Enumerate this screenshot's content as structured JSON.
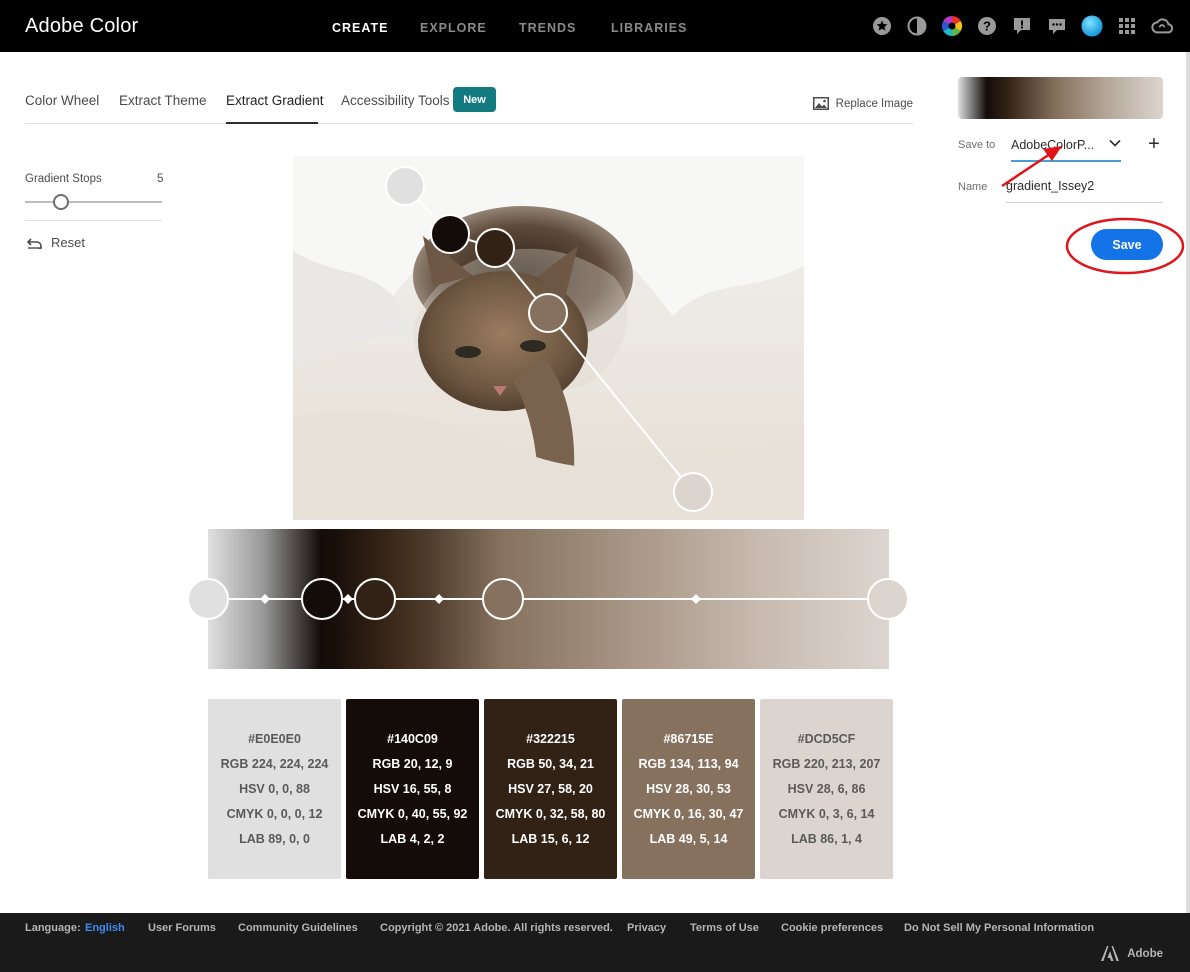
{
  "app": {
    "brand": "Adobe Color",
    "nav": [
      {
        "label": "CREATE",
        "active": true
      },
      {
        "label": "EXPLORE",
        "active": false
      },
      {
        "label": "TRENDS",
        "active": false
      },
      {
        "label": "LIBRARIES",
        "active": false
      }
    ],
    "top_icons": [
      "star-icon",
      "contrast-icon",
      "color-wheel-icon",
      "help-icon",
      "feedback-icon",
      "chat-icon",
      "user-avatar",
      "apps-grid-icon",
      "creative-cloud-icon"
    ]
  },
  "tabs": {
    "items": [
      "Color Wheel",
      "Extract Theme",
      "Extract Gradient",
      "Accessibility Tools"
    ],
    "active": "Extract Gradient",
    "new_badge": "New",
    "replace_image": "Replace Image"
  },
  "controls": {
    "gradient_stops_label": "Gradient Stops",
    "gradient_stops_value": "5",
    "reset_label": "Reset"
  },
  "swatches": [
    {
      "hex": "#E0E0E0",
      "rgb": "RGB 224, 224, 224",
      "hsv": "HSV 0, 0, 88",
      "cmyk": "CMYK 0, 0, 0, 12",
      "lab": "LAB 89, 0, 0",
      "color": "#e0e0e0"
    },
    {
      "hex": "#140C09",
      "rgb": "RGB 20, 12, 9",
      "hsv": "HSV 16, 55, 8",
      "cmyk": "CMYK 0, 40, 55, 92",
      "lab": "LAB 4, 2, 2",
      "color": "#140c09"
    },
    {
      "hex": "#322215",
      "rgb": "RGB 50, 34, 21",
      "hsv": "HSV 27, 58, 20",
      "cmyk": "CMYK 0, 32, 58, 80",
      "lab": "LAB 15, 6, 12",
      "color": "#322215"
    },
    {
      "hex": "#86715E",
      "rgb": "RGB 134, 113, 94",
      "hsv": "HSV 28, 30, 53",
      "cmyk": "CMYK 0, 16, 30, 47",
      "lab": "LAB 49, 5, 14",
      "color": "#86715e"
    },
    {
      "hex": "#DCD5CF",
      "rgb": "RGB 220, 213, 207",
      "hsv": "HSV 28, 6, 86",
      "cmyk": "CMYK 0, 3, 6, 14",
      "lab": "LAB 86, 1, 4",
      "color": "#dcd5cf"
    }
  ],
  "save_panel": {
    "save_to_label": "Save to",
    "save_to_value": "AdobeColorP...",
    "add_label": "+",
    "name_label": "Name",
    "name_value": "gradient_Issey2",
    "save_button": "Save"
  },
  "footer": {
    "language_label": "Language:",
    "language_value": "English",
    "links": [
      "User Forums",
      "Community Guidelines",
      "Copyright © 2021 Adobe. All rights reserved.",
      "Privacy",
      "Terms of Use",
      "Cookie preferences",
      "Do Not Sell My Personal Information"
    ],
    "brand": "Adobe"
  }
}
